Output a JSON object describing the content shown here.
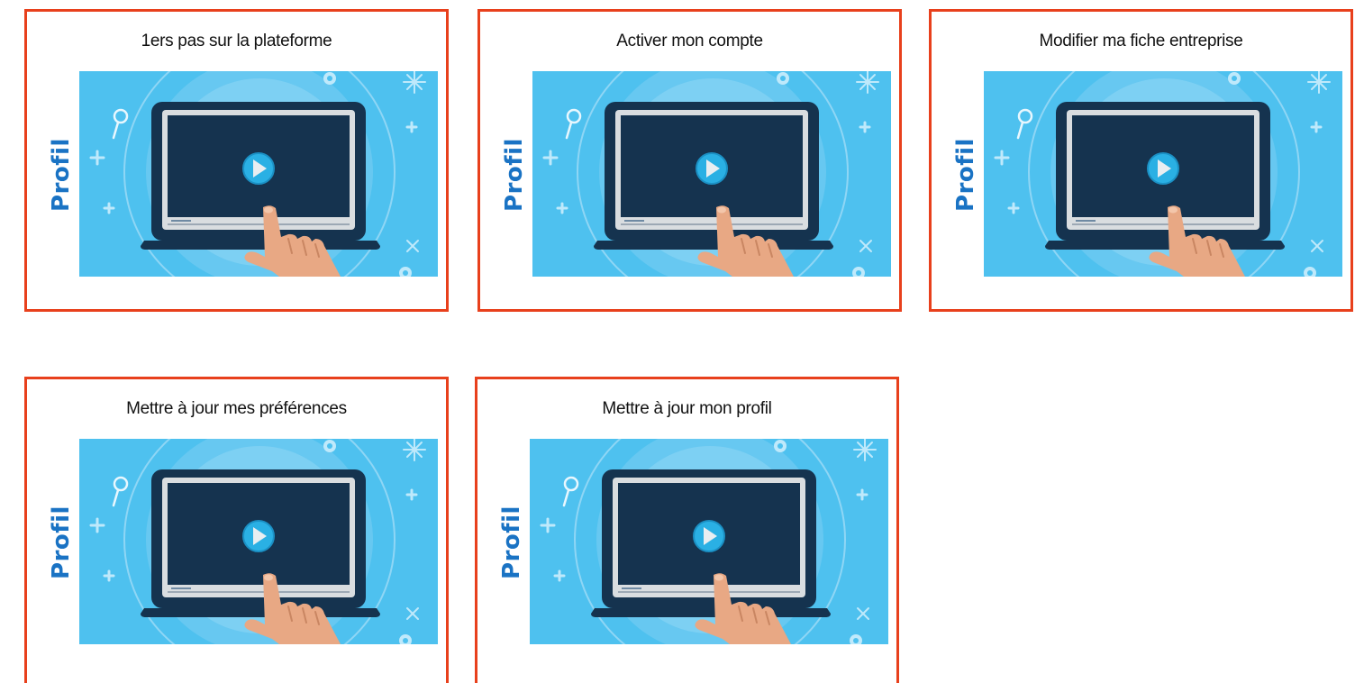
{
  "colors": {
    "card_border": "#e8401c",
    "side_label": "#1a73c4",
    "thumb_bg": "#4ec1ef",
    "screen": "#15334f",
    "play_button": "#2ab0e4",
    "hand": "#e8a884"
  },
  "icons": {
    "thumbnail": "laptop-play-video-icon"
  },
  "cards": [
    {
      "title": "1ers pas sur la plateforme",
      "label": "Profil"
    },
    {
      "title": "Activer mon compte",
      "label": "Profil"
    },
    {
      "title": "Modifier ma fiche entreprise",
      "label": "Profil"
    },
    {
      "title": "Mettre à jour mes préférences",
      "label": "Profil"
    },
    {
      "title": "Mettre à jour mon profil",
      "label": "Profil"
    }
  ]
}
